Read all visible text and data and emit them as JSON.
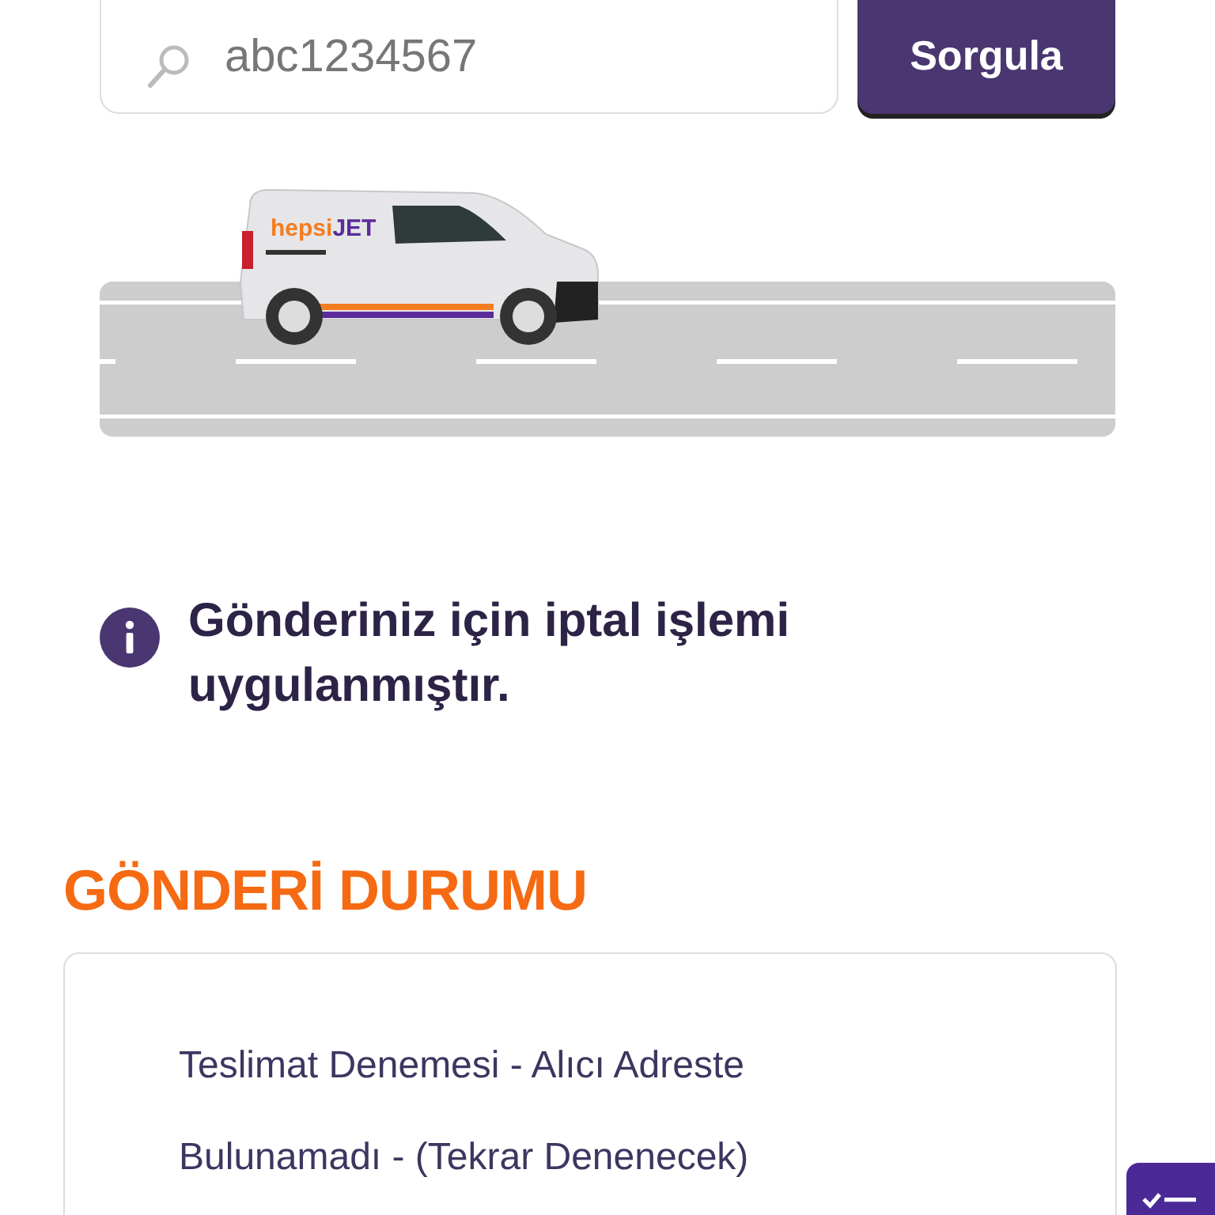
{
  "search": {
    "value": "abc1234567",
    "button": "Sorgula"
  },
  "van_logo": [
    "hepsi",
    "JET"
  ],
  "notice": "Gönderiniz için iptal işlemi uygulanmıştır.",
  "status_title": "GÖNDERİ DURUMU",
  "status_items": [
    "Teslimat Denemesi - Alıcı Adreste Bulunamadı - (Tekrar Denenecek)"
  ]
}
